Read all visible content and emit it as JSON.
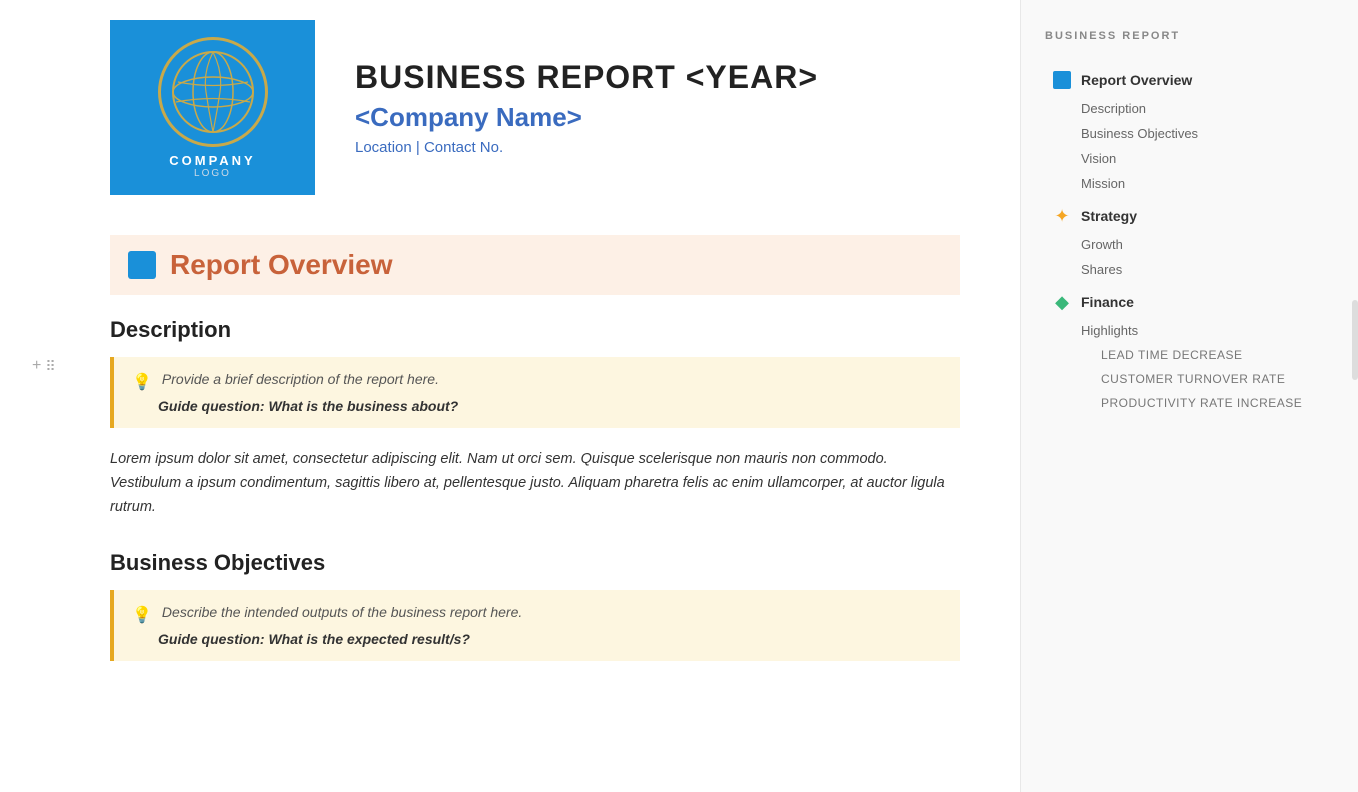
{
  "header": {
    "report_title": "BUSINESS REPORT <YEAR>",
    "company_name": "<Company Name>",
    "location": "Location | Contact No.",
    "logo_line1": "COMPANY",
    "logo_line2": "LOGO"
  },
  "section_overview": {
    "title": "Report Overview"
  },
  "description": {
    "heading": "Description",
    "tip_text": "Provide a brief description of the report here.",
    "tip_bold": "Guide question: What is the business about?",
    "lorem": "Lorem ipsum dolor sit amet, consectetur adipiscing elit. Nam ut orci sem. Quisque scelerisque non mauris non commodo. Vestibulum a ipsum condimentum, sagittis libero at, pellentesque justo. Aliquam pharetra felis ac enim ullamcorper, at auctor ligula rutrum."
  },
  "business_objectives": {
    "heading": "Business Objectives",
    "tip_text": "Describe the intended outputs of the business report here.",
    "tip_bold": "Guide question: What is the expected result/s?"
  },
  "sidebar": {
    "title": "BUSINESS REPORT",
    "nav": [
      {
        "id": "report-overview",
        "label": "Report Overview",
        "icon": "blue-square",
        "subitems": [
          {
            "label": "Description"
          },
          {
            "label": "Business Objectives"
          },
          {
            "label": "Vision"
          },
          {
            "label": "Mission"
          }
        ]
      },
      {
        "id": "strategy",
        "label": "Strategy",
        "icon": "sparkle",
        "subitems": [
          {
            "label": "Growth"
          },
          {
            "label": "Shares"
          }
        ]
      },
      {
        "id": "finance",
        "label": "Finance",
        "icon": "diamond",
        "subitems": [
          {
            "label": "Highlights"
          },
          {
            "label": "LEAD TIME DECREASE",
            "indented": true
          },
          {
            "label": "CUSTOMER TURNOVER RATE",
            "indented": true
          },
          {
            "label": "PRODUCTIVITY RATE INCREASE",
            "indented": true
          }
        ]
      }
    ]
  }
}
